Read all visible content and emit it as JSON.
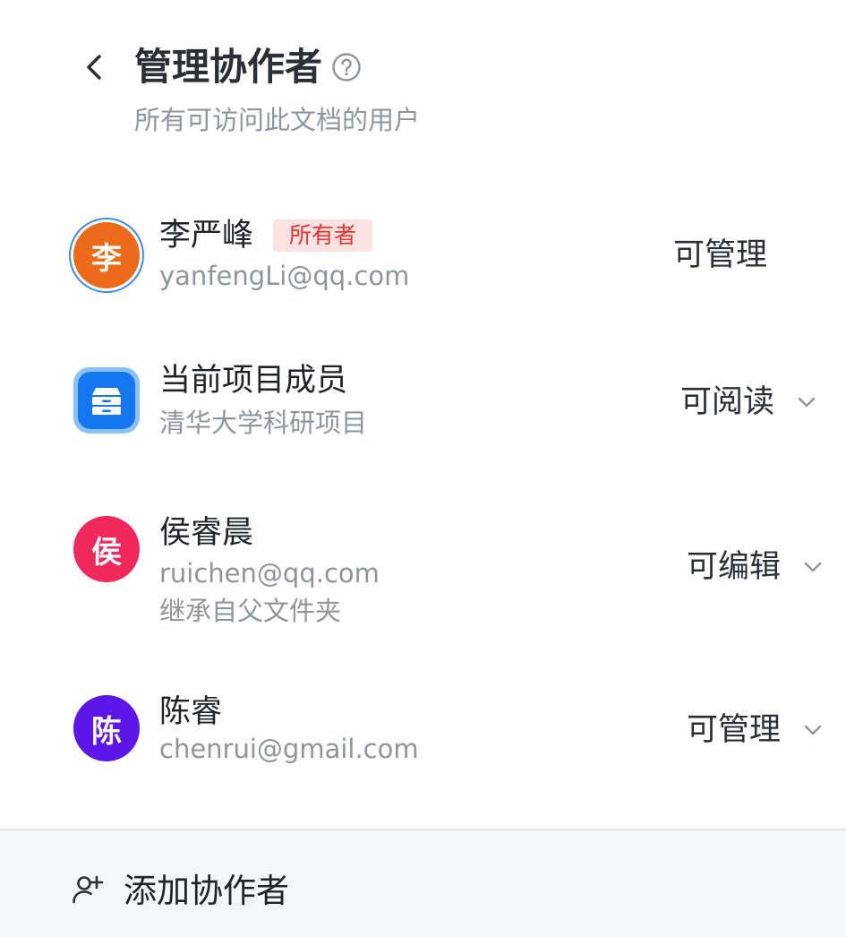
{
  "header": {
    "title": "管理协作者",
    "subtitle": "所有可访问此文档的用户"
  },
  "members": [
    {
      "avatar_text": "李",
      "avatar_color": "#ec6b1a",
      "name": "李严峰",
      "badge": "所有者",
      "detail": "yanfengLi@qq.com",
      "permission": "可管理"
    },
    {
      "icon": "project-archive-icon",
      "name": "当前项目成员",
      "detail": "清华大学科研项目",
      "permission": "可阅读"
    },
    {
      "avatar_text": "侯",
      "avatar_color": "#f0285b",
      "name": "侯睿晨",
      "detail": "ruichen@qq.com",
      "detail2": "继承自父文件夹",
      "permission": "可编辑"
    },
    {
      "avatar_text": "陈",
      "avatar_color": "#5b16e8",
      "name": "陈睿",
      "detail": "chenrui@gmail.com",
      "permission": "可管理"
    }
  ],
  "footer": {
    "add_label": "添加协作者"
  },
  "icons": {
    "back": "chevron-left-icon",
    "help": "help-circle-icon",
    "add": "add-user-icon",
    "dropdown": "chevron-down-icon"
  },
  "colors": {
    "owner_badge_bg": "#fde2e2",
    "owner_badge_text": "#e8332f",
    "secondary_text": "#8f959e",
    "footer_bg": "#f5f6f7"
  }
}
